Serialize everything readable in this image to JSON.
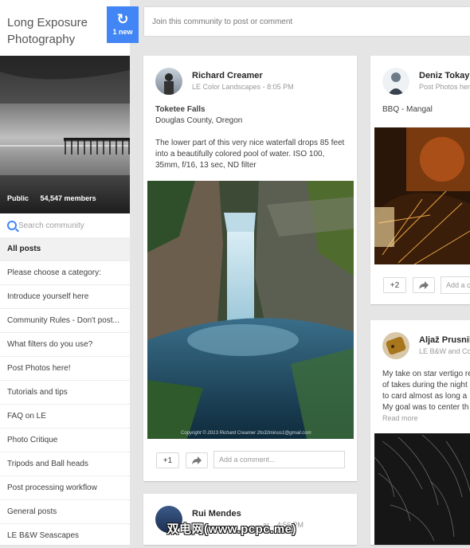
{
  "community": {
    "title": "Long Exposure Photography",
    "new_count_label": "1 new",
    "visibility": "Public",
    "members": "54,547 members",
    "search_placeholder": "Search community"
  },
  "categories": [
    "All posts",
    "Please choose a category:",
    "Introduce yourself here",
    "Community Rules - Don't post...",
    "What filters do you use?",
    "Post Photos here!",
    "Tutorials and tips",
    "FAQ on LE",
    "Photo Critique",
    "Tripods and Ball heads",
    "Post processing workflow",
    "General posts",
    "LE B&W Seascapes"
  ],
  "join_prompt": "Join this community to post or comment",
  "posts": [
    {
      "author": "Richard Creamer",
      "category": "LE Color Landscapes",
      "time": "8:05 PM",
      "title": "Toketee Falls",
      "location": "Douglas County, Oregon",
      "body": "The lower part of this very nice waterfall drops 85 feet into a beautifully colored pool of water.  ISO 100, 35mm, f/16, 13 sec, ND filter",
      "image_caption": "Copyright © 2013 Richard Creamer 2to32minus1@gmail.com",
      "plus_label": "+1",
      "comment_placeholder": "Add a comment..."
    },
    {
      "author": "Deniz Tokay",
      "category": "Post Photos here!",
      "body": "BBQ - Mangal",
      "plus_label": "+2",
      "comment_placeholder": "Add a c"
    },
    {
      "author": "Aljaž Prusnik",
      "category": "LE B&W and Col",
      "body": "My take on star vertigo re of takes during the night to card almost as long a My goal was to center th",
      "read_more": "Read more"
    },
    {
      "author": "Rui Mendes",
      "meta": "ar... 4:56 PM"
    }
  ],
  "watermark": "双电网(www.pcpc.me)",
  "colors": {
    "accent": "#4285f4",
    "background": "#e5e5e5"
  }
}
